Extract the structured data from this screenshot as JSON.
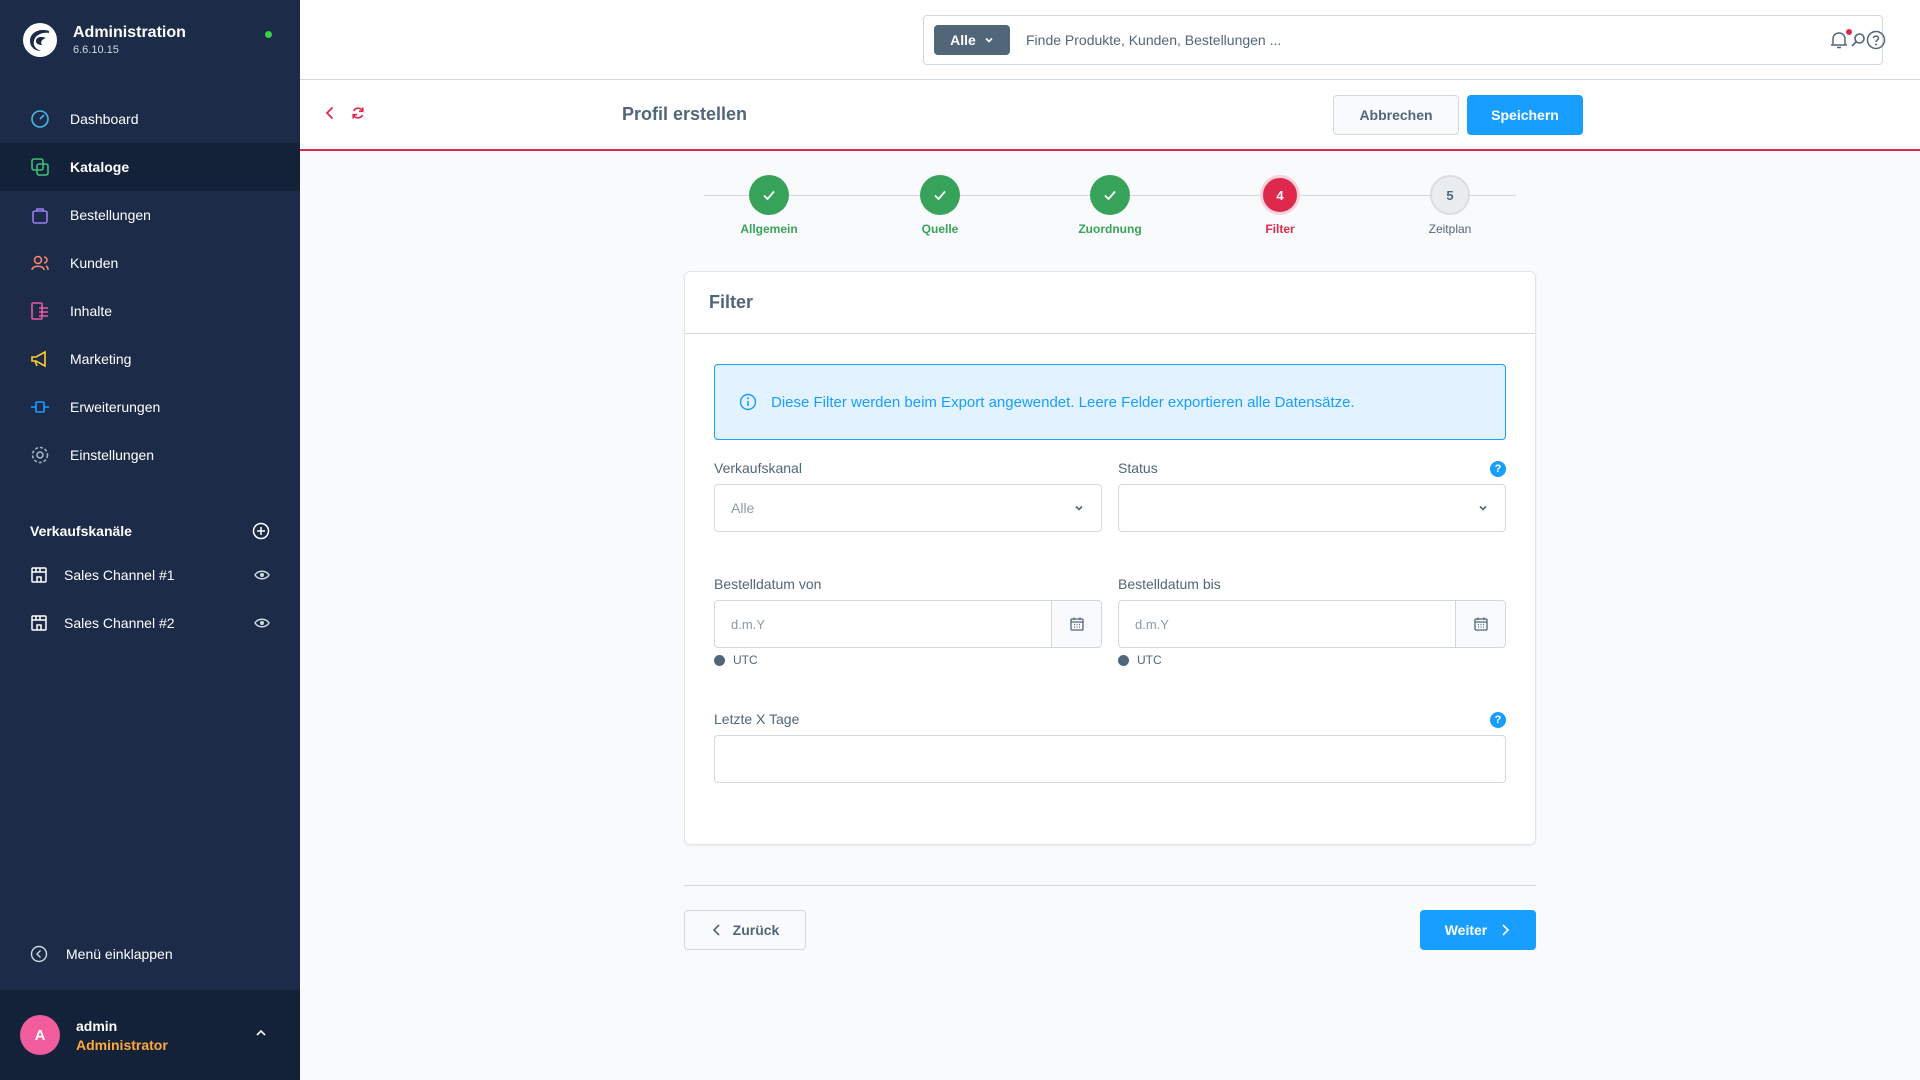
{
  "app": {
    "title": "Administration",
    "version": "6.6.10.15"
  },
  "sidebar": {
    "items": [
      {
        "label": "Dashboard",
        "icon": "dashboard-icon"
      },
      {
        "label": "Kataloge",
        "icon": "catalog-icon",
        "active": true
      },
      {
        "label": "Bestellungen",
        "icon": "shopping-bag-icon"
      },
      {
        "label": "Kunden",
        "icon": "customers-icon"
      },
      {
        "label": "Inhalte",
        "icon": "content-icon"
      },
      {
        "label": "Marketing",
        "icon": "megaphone-icon"
      },
      {
        "label": "Erweiterungen",
        "icon": "plug-icon"
      },
      {
        "label": "Einstellungen",
        "icon": "gear-icon"
      }
    ],
    "sales_channels_title": "Verkaufskanäle",
    "sales_channels": [
      {
        "label": "Sales Channel #1"
      },
      {
        "label": "Sales Channel #2"
      }
    ],
    "collapse_label": "Menü einklappen",
    "user": {
      "initial": "A",
      "name": "admin",
      "role": "Administrator"
    }
  },
  "topbar": {
    "search_type": "Alle",
    "search_placeholder": "Finde Produkte, Kunden, Bestellungen ..."
  },
  "smartbar": {
    "title": "Profil erstellen",
    "cancel_label": "Abbrechen",
    "save_label": "Speichern"
  },
  "stepper": {
    "steps": [
      {
        "label": "Allgemein",
        "state": "done"
      },
      {
        "label": "Quelle",
        "state": "done"
      },
      {
        "label": "Zuordnung",
        "state": "done"
      },
      {
        "label": "Filter",
        "number": "4",
        "state": "current"
      },
      {
        "label": "Zeitplan",
        "number": "5",
        "state": "todo"
      }
    ]
  },
  "card": {
    "title": "Filter",
    "info_text": "Diese Filter werden beim Export angewendet. Leere Felder exportieren alle Datensätze.",
    "fields": {
      "sales_channel_label": "Verkaufskanal",
      "sales_channel_value": "Alle",
      "status_label": "Status",
      "status_value": "",
      "order_date_from_label": "Bestelldatum von",
      "order_date_from_placeholder": "d.m.Y",
      "order_date_to_label": "Bestelldatum bis",
      "order_date_to_placeholder": "d.m.Y",
      "timezone": "UTC",
      "last_days_label": "Letzte X Tage",
      "last_days_value": "",
      "help_glyph": "?"
    }
  },
  "footer": {
    "back_label": "Zurück",
    "next_label": "Weiter"
  },
  "colors": {
    "sidebar_bg": "#1b2b48",
    "accent": "#189eff",
    "success": "#37a35a",
    "danger": "#de294c",
    "role": "#ffa93b"
  }
}
